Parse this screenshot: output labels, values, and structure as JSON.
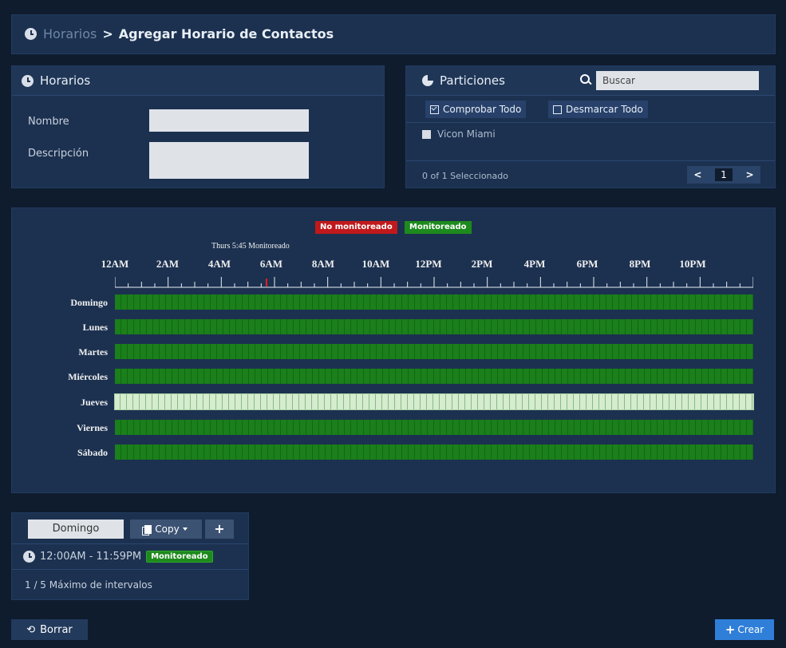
{
  "breadcrumb": {
    "parent": "Horarios",
    "separator": ">",
    "current": "Agregar Horario de Contactos"
  },
  "horarios_panel": {
    "title": "Horarios",
    "name_label": "Nombre",
    "name_value": "",
    "description_label": "Descripción",
    "description_value": ""
  },
  "particiones_panel": {
    "title": "Particiones",
    "search_placeholder": "Buscar",
    "check_all_label": "Comprobar Todo",
    "uncheck_all_label": "Desmarcar Todo",
    "items": [
      {
        "label": "Vicon Miami",
        "checked": false
      }
    ],
    "selected_text": "0 of 1 Seleccionado",
    "current_page": "1"
  },
  "schedule": {
    "legend": {
      "not_monitored": "No monitoreado",
      "monitored": "Monitoreado",
      "not_monitored_color": "#c0191c",
      "monitored_color": "#1d8a1d"
    },
    "marker_label": "Thurs 5:45 Monitoreado",
    "hour_labels": [
      "12AM",
      "2AM",
      "4AM",
      "6AM",
      "8AM",
      "10AM",
      "12PM",
      "2PM",
      "4PM",
      "6PM",
      "8PM",
      "10PM"
    ],
    "days": [
      "Domingo",
      "Lunes",
      "Martes",
      "Miércoles",
      "Jueves",
      "Viernes",
      "Sábado"
    ],
    "selected_day": "Jueves"
  },
  "intervals_panel": {
    "selected_day": "Domingo",
    "copy_label": "Copy",
    "add_label": "+",
    "interval_range": "12:00AM - 11:59PM",
    "interval_status": "Monitoreado",
    "max_text": "1 / 5 Máximo de intervalos"
  },
  "actions": {
    "reset_label": "Borrar",
    "create_label": "Crear"
  }
}
